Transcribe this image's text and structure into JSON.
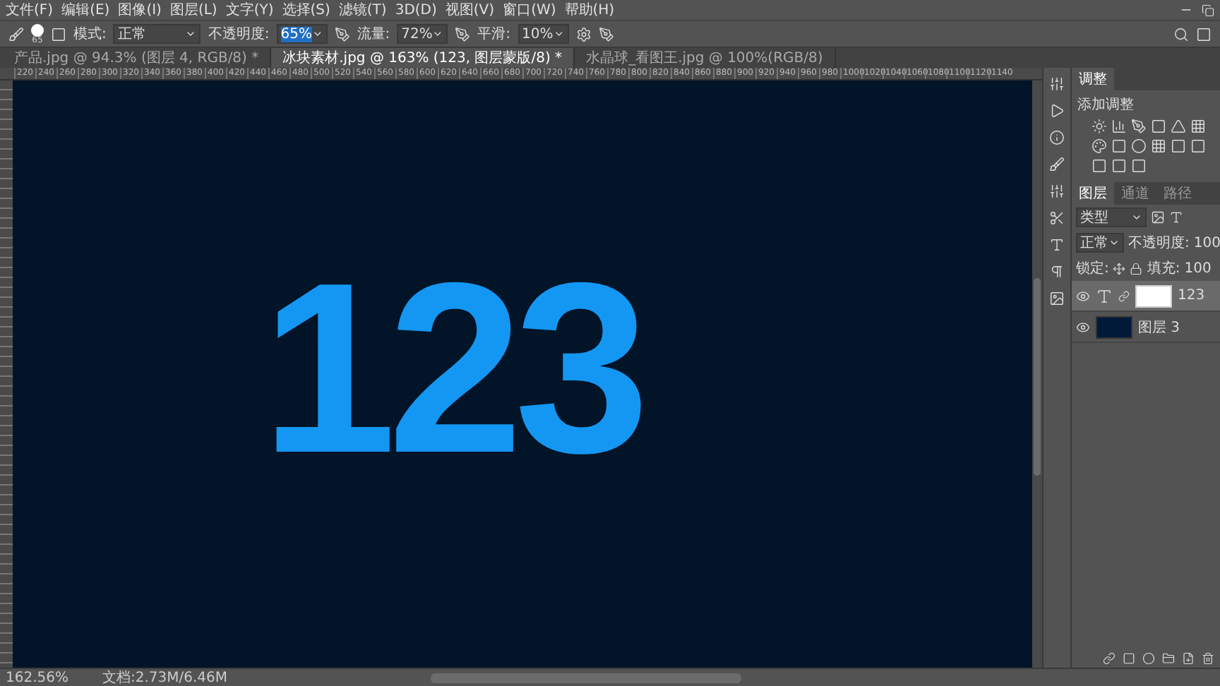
{
  "menu_bar": {
    "items": [
      "文件(F)",
      "编辑(E)",
      "图像(I)",
      "图层(L)",
      "文字(Y)",
      "选择(S)",
      "滤镜(T)",
      "3D(D)",
      "视图(V)",
      "窗口(W)",
      "帮助(H)"
    ]
  },
  "options_bar": {
    "brush_size": "65",
    "mode_label": "模式:",
    "mode": "正常",
    "opacity_label": "不透明度:",
    "opacity": "65%",
    "flow_label": "流量:",
    "flow": "72%",
    "smoothing_label": "平滑:",
    "smoothing": "10%"
  },
  "document_tabs": [
    {
      "label": "产品.jpg @ 94.3% (图层 4, RGB/8) *",
      "selected": false
    },
    {
      "label": "冰块素材.jpg @ 163% (123, 图层蒙版/8) *",
      "selected": true
    },
    {
      "label": "水晶球_看图王.jpg @ 100%(RGB/8)",
      "selected": false
    }
  ],
  "ruler_top": {
    "labels": [
      "220",
      "240",
      "260",
      "280",
      "300",
      "320",
      "340",
      "360",
      "380",
      "400",
      "420",
      "440",
      "460",
      "480",
      "500",
      "520",
      "540",
      "560",
      "580",
      "600",
      "620",
      "640",
      "660",
      "680",
      "700",
      "720",
      "740",
      "760",
      "780",
      "800",
      "820",
      "840",
      "860",
      "880",
      "900",
      "920",
      "940",
      "960",
      "980",
      "1000",
      "1020",
      "1040",
      "1060",
      "1080",
      "1100",
      "1120",
      "1140"
    ]
  },
  "canvas": {
    "text": "123"
  },
  "adjustments_panel": {
    "tab": "调整",
    "title": "添加调整"
  },
  "layers_panel": {
    "tabs": [
      {
        "label": "图层",
        "selected": true
      },
      {
        "label": "通道",
        "selected": false
      },
      {
        "label": "路径",
        "selected": false
      }
    ],
    "filter": "类型",
    "blend_mode": "正常",
    "opacity_label": "不透明度:",
    "opacity": "100",
    "lock_label": "锁定:",
    "fill_label": "填充:",
    "fill": "100",
    "layers": [
      {
        "name": "123",
        "kind": "text",
        "selected": true,
        "visible": true
      },
      {
        "name": "图层 3",
        "kind": "image",
        "selected": false,
        "visible": true
      }
    ]
  },
  "status_bar": {
    "zoom": "162.56%",
    "document": "文档:2.73M/6.46M"
  }
}
